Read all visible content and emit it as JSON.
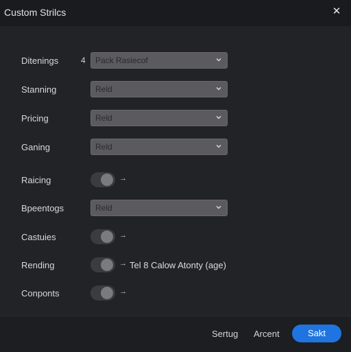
{
  "window": {
    "title": "Custom Strilcs",
    "close_glyph": "✕"
  },
  "rows": [
    {
      "label": "Ditenings",
      "prefix": "4",
      "type": "select",
      "value": "Pack Rasiecof"
    },
    {
      "label": "Stanning",
      "type": "select",
      "value": "Reld"
    },
    {
      "label": "Pricing",
      "type": "select",
      "value": "Reld"
    },
    {
      "label": "Ganing",
      "type": "select",
      "value": "Reld"
    },
    {
      "label": "Raicing",
      "type": "toggle",
      "arrow": "→"
    },
    {
      "label": "Bpeentogs",
      "type": "select",
      "value": "Reld"
    },
    {
      "label": "Castuies",
      "type": "toggle",
      "arrow": "→"
    },
    {
      "label": "Rending",
      "type": "toggle",
      "arrow": "→",
      "note": "Tel 8 Calow Atonty (age)"
    },
    {
      "label": "Conponts",
      "type": "toggle",
      "arrow": "→"
    }
  ],
  "footer": {
    "secondary_1": "Sertug",
    "secondary_2": "Arcent",
    "primary": "Sakt"
  },
  "colors": {
    "primary_button": "#1f74e0",
    "background": "#222326",
    "select_fill": "#5b5b5f"
  }
}
